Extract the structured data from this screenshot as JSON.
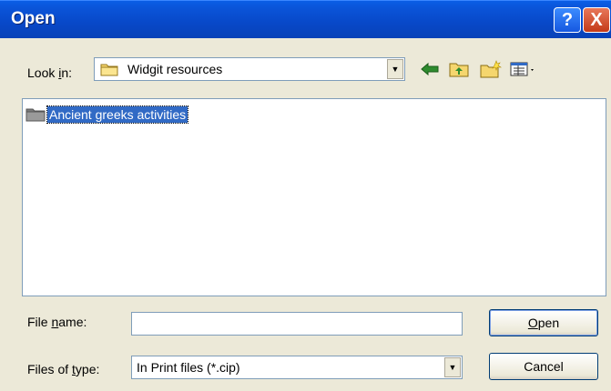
{
  "window": {
    "title": "Open",
    "help_glyph": "?",
    "close_glyph": "X"
  },
  "lookin": {
    "label_pre": "Look ",
    "label_key": "i",
    "label_post": "n:",
    "value": "Widgit resources"
  },
  "toolbar": {
    "icons": [
      "back-icon",
      "up-folder-icon",
      "new-folder-icon",
      "view-menu-icon"
    ]
  },
  "file_list": {
    "items": [
      {
        "name": "Ancient greeks activities",
        "icon": "folder-icon",
        "selected": true
      }
    ]
  },
  "file_name": {
    "label_pre": "File ",
    "label_key": "n",
    "label_post": "ame:",
    "value": ""
  },
  "file_type": {
    "label_pre": "Files of ",
    "label_key": "t",
    "label_post": "ype:",
    "value": "In Print files (*.cip)"
  },
  "buttons": {
    "open_key": "O",
    "open_rest": "pen",
    "cancel": "Cancel"
  },
  "colors": {
    "title_bar": "#0a54d8",
    "selection": "#316ac5",
    "dialog_bg": "#ece9d8"
  }
}
